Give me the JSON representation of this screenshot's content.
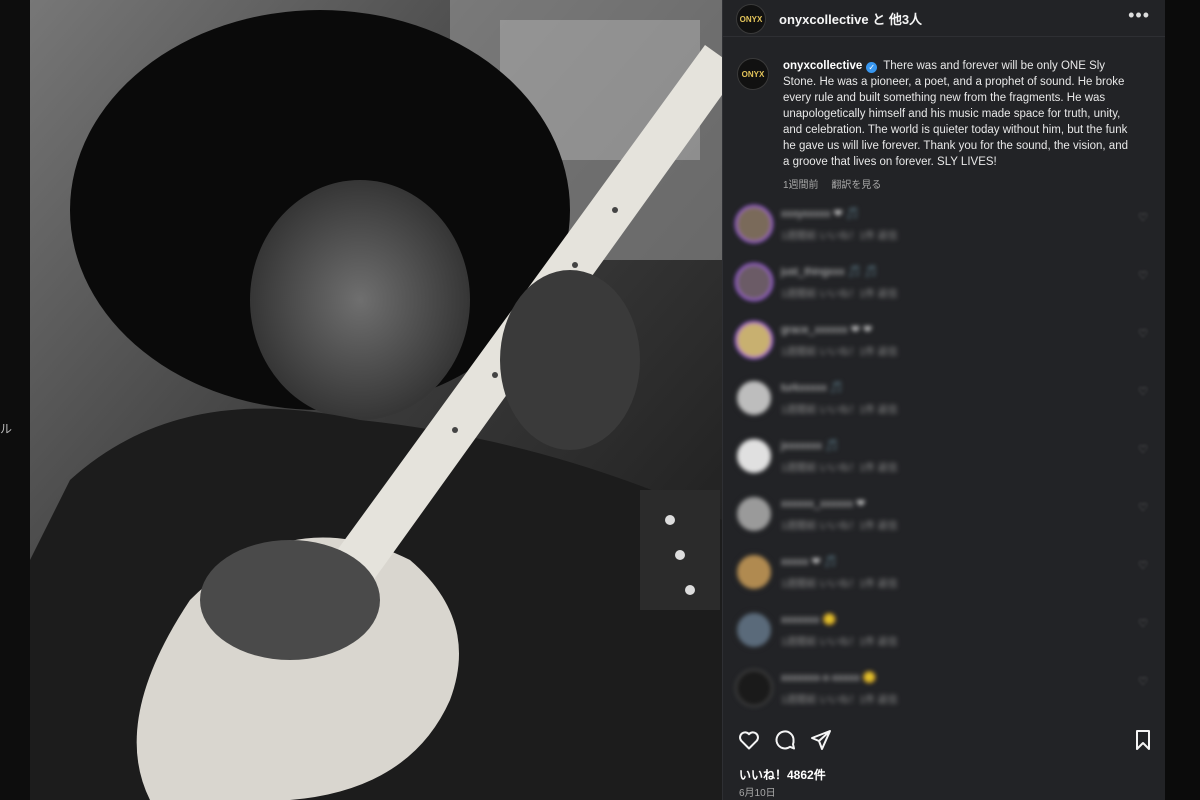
{
  "left_edge_text": "ル",
  "header": {
    "avatar_text": "ONYX",
    "title": "onyxcollective と 他3人",
    "more_label": "•••"
  },
  "caption": {
    "username": "onyxcollective",
    "verified_mark": "✓",
    "text": "There was and forever will be only ONE Sly Stone. He was a pioneer, a poet, and a prophet of sound. He broke every rule and built something new from the fragments. He was unapologetically himself and his music made space for truth, unity, and celebration. The world is quieter today without him, but the funk he gave us will live forever. Thank you for the sound, the vision, and a groove that lives on forever. SLY LIVES!",
    "time_ago": "1週間前",
    "translate": "翻訳を見る"
  },
  "comments": [
    {
      "name": "xxxyxxxxx ❤ 🎵",
      "sub": "1週間前  いいね！1件  返信"
    },
    {
      "name": "just_thingxxx 🎵 🎵",
      "sub": "1週間前  いいね！1件  返信"
    },
    {
      "name": "grace_xxxxxx ❤ ❤",
      "sub": "1週間前  いいね！1件  返信"
    },
    {
      "name": "turkxxxxx 🎵",
      "sub": "1週間前  いいね！1件  返信"
    },
    {
      "name": "jxxxxxxx 🎵",
      "sub": "1週間前  いいね！1件  返信"
    },
    {
      "name": "xxxxxx_xxxxxx ❤",
      "sub": "1週間前  いいね！1件  返信"
    },
    {
      "name": "xxxxx ❤ 🎵",
      "sub": "1週間前  いいね！1件  返信"
    },
    {
      "name": "xxxxxxx 🙂",
      "sub": "1週間前  いいね！1件  返信"
    },
    {
      "name": "xxxxxxx-x-xxxxx 🙂",
      "sub": "1週間前  いいね！1件  返信"
    }
  ],
  "comment_heart": "♡",
  "likes": "いいね！4862件",
  "date": "6月10日",
  "colors": {
    "panel": "#222326",
    "accent": "#3897f0",
    "story_ring": "#b56cff"
  }
}
